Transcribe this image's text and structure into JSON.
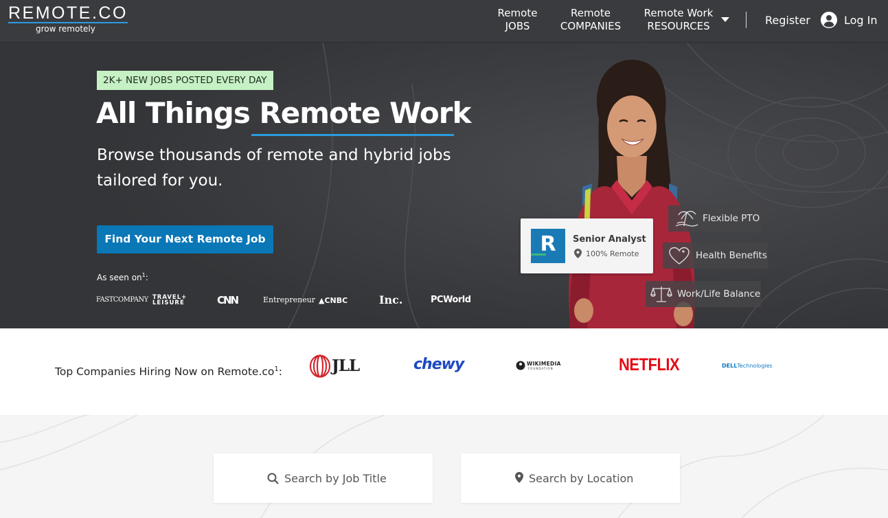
{
  "header": {
    "logo_text": "REMOTE.CO",
    "logo_tagline": "grow remotely",
    "nav": [
      {
        "line1": "Remote",
        "line2": "JOBS"
      },
      {
        "line1": "Remote",
        "line2": "COMPANIES"
      },
      {
        "line1": "Remote Work",
        "line2": "RESOURCES"
      }
    ],
    "register": "Register",
    "login": "Log In"
  },
  "hero": {
    "badge": "2K+ NEW JOBS POSTED EVERY DAY",
    "title_part1": "All Things ",
    "title_part2": "Remote Work",
    "subtitle": "Browse thousands of remote and hybrid jobs tailored for you.",
    "cta": "Find Your Next Remote Job",
    "seen_on": "As seen on",
    "seen_on_sup": "1",
    "seen_on_suffix": ":",
    "media": [
      "FASTCOMPANY",
      "TRAVEL+",
      "LEISURE",
      "CNN",
      "Entrepreneur",
      "CNBC",
      "Inc.",
      "PCWorld"
    ],
    "job_card": {
      "logo_letter": "R",
      "title": "Senior Analyst",
      "location": "100% Remote"
    },
    "perks": [
      "Flexible PTO",
      "Health Benefits",
      "Work/Life Balance"
    ]
  },
  "companies": {
    "label": "Top Companies Hiring Now on Remote.co",
    "label_sup": "1",
    "label_suffix": ":",
    "logos": [
      "JLL",
      "chewy",
      "WIKIMEDIA",
      "FOUNDATION",
      "NETFLIX",
      "DELL",
      "Technologies"
    ]
  },
  "search": {
    "job_title_placeholder": "Search by Job Title",
    "location_placeholder": "Search by Location"
  },
  "colors": {
    "header_bg": "#3a3b3e",
    "hero_bg": "#38393c",
    "accent": "#2b9ce0",
    "cta": "#0a77b7",
    "badge": "#c6f1c5"
  }
}
